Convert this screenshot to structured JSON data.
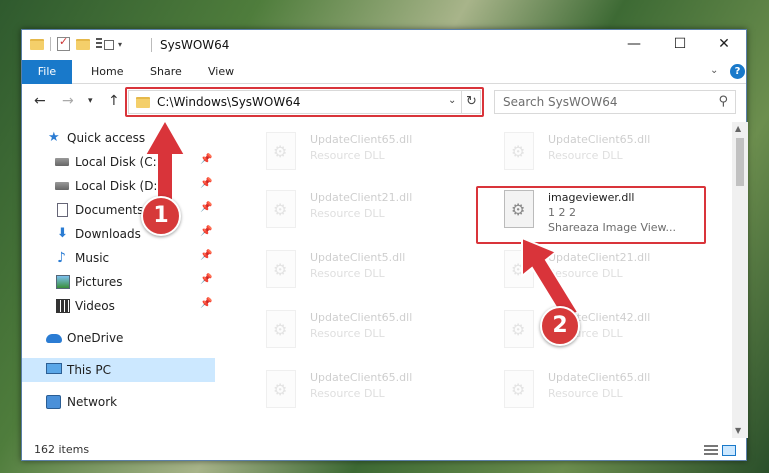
{
  "window": {
    "title": "SysWOW64",
    "controls": {
      "minimize": "—",
      "maximize": "☐",
      "close": "✕"
    }
  },
  "ribbon": {
    "tabs": [
      "File",
      "Home",
      "Share",
      "View"
    ],
    "help": "?"
  },
  "address": {
    "path": "C:\\Windows\\SysWOW64",
    "search_placeholder": "Search SysWOW64"
  },
  "nav": {
    "items": [
      {
        "label": "Quick access",
        "icon": "star-icon"
      },
      {
        "label": "Local Disk (C:)",
        "icon": "drive-icon",
        "pinned": true
      },
      {
        "label": "Local Disk (D:)",
        "icon": "drive-icon",
        "pinned": true
      },
      {
        "label": "Documents",
        "icon": "documents-icon",
        "pinned": true
      },
      {
        "label": "Downloads",
        "icon": "downloads-icon",
        "pinned": true
      },
      {
        "label": "Music",
        "icon": "music-icon",
        "pinned": true
      },
      {
        "label": "Pictures",
        "icon": "pictures-icon",
        "pinned": true
      },
      {
        "label": "Videos",
        "icon": "videos-icon",
        "pinned": true
      },
      {
        "label": "OneDrive",
        "icon": "onedrive-icon"
      },
      {
        "label": "This PC",
        "icon": "this-pc-icon",
        "selected": true
      },
      {
        "label": "Network",
        "icon": "network-icon"
      }
    ]
  },
  "files": [
    {
      "name": "UpdateClient65.dll",
      "desc": "Resource DLL"
    },
    {
      "name": "UpdateClient65.dll",
      "desc": "Resource DLL"
    },
    {
      "name": "UpdateClient21.dll",
      "desc": "Resource DLL"
    },
    {
      "name": "imageviewer.dll",
      "version": "1 2 2",
      "desc": "Shareaza Image View...",
      "selected": true
    },
    {
      "name": "UpdateClient5.dll",
      "desc": "Resource DLL"
    },
    {
      "name": "UpdateClient21.dll",
      "desc": "Resource DLL"
    },
    {
      "name": "UpdateClient65.dll",
      "desc": "Resource DLL"
    },
    {
      "name": "UpdateClient42.dll",
      "desc": "Resource DLL"
    },
    {
      "name": "UpdateClient65.dll",
      "desc": "Resource DLL"
    },
    {
      "name": "UpdateClient65.dll",
      "desc": "Resource DLL"
    }
  ],
  "status": {
    "items_count": "162 items"
  },
  "annotations": {
    "step1": "1",
    "step2": "2"
  },
  "colors": {
    "accent": "#1979ca",
    "highlight": "#d9343a",
    "selection": "#cce8ff"
  }
}
